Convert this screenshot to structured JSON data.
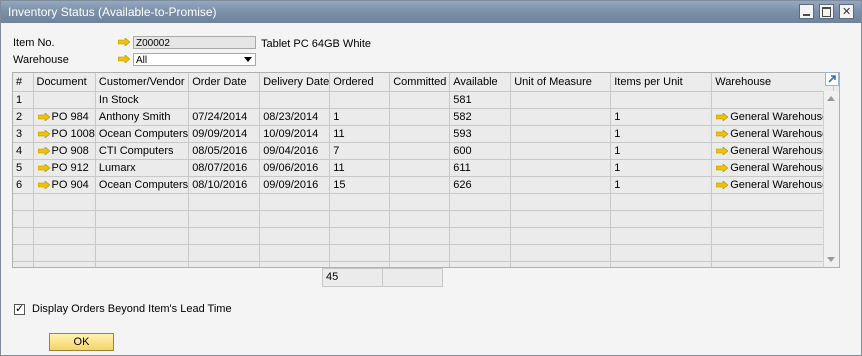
{
  "window": {
    "title": "Inventory Status (Available-to-Promise)"
  },
  "header": {
    "item_no_label": "Item No.",
    "item_no_value": "Z00002",
    "item_description": "Tablet PC 64GB White",
    "warehouse_label": "Warehouse",
    "warehouse_value": "All"
  },
  "grid": {
    "columns": [
      "#",
      "Document",
      "Customer/Vendor",
      "Order Date",
      "Delivery Date",
      "Ordered",
      "Committed",
      "Available",
      "Unit of Measure",
      "Items per Unit",
      "Warehouse"
    ],
    "rows": [
      {
        "num": "1",
        "document": "",
        "customer": "In Stock",
        "order_date": "",
        "delivery_date": "",
        "ordered": "",
        "committed": "",
        "available": "581",
        "uom": "",
        "items_per_unit": "",
        "warehouse": ""
      },
      {
        "num": "2",
        "document": "PO 984",
        "customer": "Anthony Smith",
        "order_date": "07/24/2014",
        "delivery_date": "08/23/2014",
        "ordered": "1",
        "committed": "",
        "available": "582",
        "uom": "",
        "items_per_unit": "1",
        "warehouse": "General Warehouse"
      },
      {
        "num": "3",
        "document": "PO 1008",
        "customer": "Ocean Computers",
        "order_date": "09/09/2014",
        "delivery_date": "10/09/2014",
        "ordered": "11",
        "committed": "",
        "available": "593",
        "uom": "",
        "items_per_unit": "1",
        "warehouse": "General Warehouse"
      },
      {
        "num": "4",
        "document": "PO 908",
        "customer": "CTI Computers",
        "order_date": "08/05/2016",
        "delivery_date": "09/04/2016",
        "ordered": "7",
        "committed": "",
        "available": "600",
        "uom": "",
        "items_per_unit": "1",
        "warehouse": "General Warehouse"
      },
      {
        "num": "5",
        "document": "PO 912",
        "customer": "Lumarx",
        "order_date": "08/07/2016",
        "delivery_date": "09/06/2016",
        "ordered": "11",
        "committed": "",
        "available": "611",
        "uom": "",
        "items_per_unit": "1",
        "warehouse": "General Warehouse"
      },
      {
        "num": "6",
        "document": "PO 904",
        "customer": "Ocean Computers",
        "order_date": "08/10/2016",
        "delivery_date": "09/09/2016",
        "ordered": "15",
        "committed": "",
        "available": "626",
        "uom": "",
        "items_per_unit": "1",
        "warehouse": "General Warehouse"
      }
    ],
    "empty_rows": 5,
    "total_ordered": "45"
  },
  "options": {
    "display_orders_label": "Display Orders Beyond Item's Lead Time",
    "display_orders_checked": true
  },
  "buttons": {
    "ok_label": "OK"
  },
  "colors": {
    "title_bar": "#7d90aa",
    "link_arrow": "#f2c200",
    "ok_button": "#f5d36a"
  }
}
